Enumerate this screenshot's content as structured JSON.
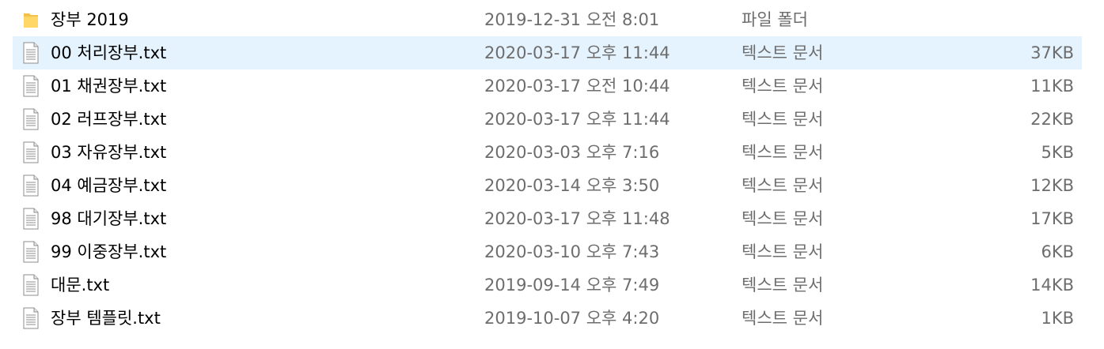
{
  "files": [
    {
      "name": "장부 2019",
      "modified": "2019-12-31 오전 8:01",
      "type": "파일 폴더",
      "size": "",
      "icon": "folder-icon",
      "selected": false
    },
    {
      "name": "00 처리장부.txt",
      "modified": "2020-03-17 오후 11:44",
      "type": "텍스트 문서",
      "size": "37KB",
      "icon": "text-file-icon",
      "selected": true
    },
    {
      "name": "01 채권장부.txt",
      "modified": "2020-03-17 오전 10:44",
      "type": "텍스트 문서",
      "size": "11KB",
      "icon": "text-file-icon",
      "selected": false
    },
    {
      "name": "02 러프장부.txt",
      "modified": "2020-03-17 오후 11:44",
      "type": "텍스트 문서",
      "size": "22KB",
      "icon": "text-file-icon",
      "selected": false
    },
    {
      "name": "03 자유장부.txt",
      "modified": "2020-03-03 오후 7:16",
      "type": "텍스트 문서",
      "size": "5KB",
      "icon": "text-file-icon",
      "selected": false
    },
    {
      "name": "04 예금장부.txt",
      "modified": "2020-03-14 오후 3:50",
      "type": "텍스트 문서",
      "size": "12KB",
      "icon": "text-file-icon",
      "selected": false
    },
    {
      "name": "98 대기장부.txt",
      "modified": "2020-03-17 오후 11:48",
      "type": "텍스트 문서",
      "size": "17KB",
      "icon": "text-file-icon",
      "selected": false
    },
    {
      "name": "99 이중장부.txt",
      "modified": "2020-03-10 오후 7:43",
      "type": "텍스트 문서",
      "size": "6KB",
      "icon": "text-file-icon",
      "selected": false
    },
    {
      "name": "대문.txt",
      "modified": "2019-09-14 오후 7:49",
      "type": "텍스트 문서",
      "size": "14KB",
      "icon": "text-file-icon",
      "selected": false
    },
    {
      "name": "장부 템플릿.txt",
      "modified": "2019-10-07 오후 4:20",
      "type": "텍스트 문서",
      "size": "1KB",
      "icon": "text-file-icon",
      "selected": false
    }
  ],
  "colors": {
    "selected_row": "#e5f3ff",
    "folder": "#f4c04a",
    "secondary_text": "#6d6d6d"
  }
}
